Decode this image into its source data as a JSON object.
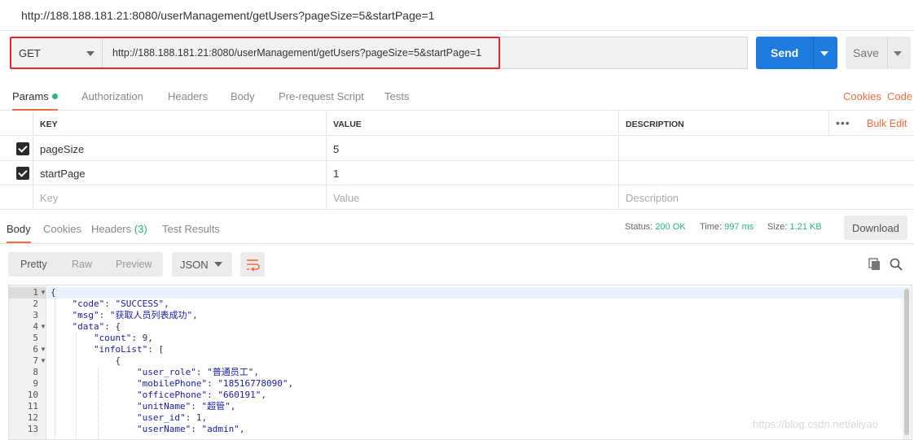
{
  "window": {
    "title": "http://188.188.181.21:8080/userManagement/getUsers?pageSize=5&startPage=1"
  },
  "request": {
    "method": "GET",
    "url": "http://188.188.181.21:8080/userManagement/getUsers?pageSize=5&startPage=1",
    "send_label": "Send",
    "save_label": "Save"
  },
  "request_tabs": [
    "Params",
    "Authorization",
    "Headers",
    "Body",
    "Pre-request Script",
    "Tests"
  ],
  "request_links": {
    "cookies": "Cookies",
    "code": "Code"
  },
  "params": {
    "headers": {
      "key": "KEY",
      "value": "VALUE",
      "description": "DESCRIPTION"
    },
    "bulk_edit": "Bulk Edit",
    "rows": [
      {
        "checked": true,
        "key": "pageSize",
        "value": "5",
        "description": ""
      },
      {
        "checked": true,
        "key": "startPage",
        "value": "1",
        "description": ""
      }
    ],
    "placeholder": {
      "key": "Key",
      "value": "Value",
      "description": "Description"
    }
  },
  "response_tabs": {
    "body": "Body",
    "cookies": "Cookies",
    "headers": "Headers",
    "headers_count": "(3)",
    "tests": "Test Results"
  },
  "response_status": {
    "status_label": "Status:",
    "status": "200 OK",
    "time_label": "Time:",
    "time": "997 ms",
    "size_label": "Size:",
    "size": "1.21 KB",
    "download": "Download"
  },
  "view_options": {
    "pretty": "Pretty",
    "raw": "Raw",
    "preview": "Preview",
    "format": "JSON"
  },
  "code_lines": [
    {
      "n": "1",
      "fold": true,
      "indent": 0,
      "text": "{"
    },
    {
      "n": "2",
      "fold": false,
      "indent": 1,
      "text": "\"code\": \"SUCCESS\","
    },
    {
      "n": "3",
      "fold": false,
      "indent": 1,
      "text": "\"msg\": \"获取人员列表成功\","
    },
    {
      "n": "4",
      "fold": true,
      "indent": 1,
      "text": "\"data\": {"
    },
    {
      "n": "5",
      "fold": false,
      "indent": 2,
      "text": "\"count\": 9,"
    },
    {
      "n": "6",
      "fold": true,
      "indent": 2,
      "text": "\"infoList\": ["
    },
    {
      "n": "7",
      "fold": true,
      "indent": 3,
      "text": "{"
    },
    {
      "n": "8",
      "fold": false,
      "indent": 4,
      "text": "\"user_role\": \"普通员工\","
    },
    {
      "n": "9",
      "fold": false,
      "indent": 4,
      "text": "\"mobilePhone\": \"18516778090\","
    },
    {
      "n": "10",
      "fold": false,
      "indent": 4,
      "text": "\"officePhone\": \"660191\","
    },
    {
      "n": "11",
      "fold": false,
      "indent": 4,
      "text": "\"unitName\": \"超管\","
    },
    {
      "n": "12",
      "fold": false,
      "indent": 4,
      "text": "\"user_id\": 1,"
    },
    {
      "n": "13",
      "fold": false,
      "indent": 4,
      "text": "\"userName\": \"admin\","
    }
  ],
  "watermark": "https://blog.csdn.net/aliyao"
}
